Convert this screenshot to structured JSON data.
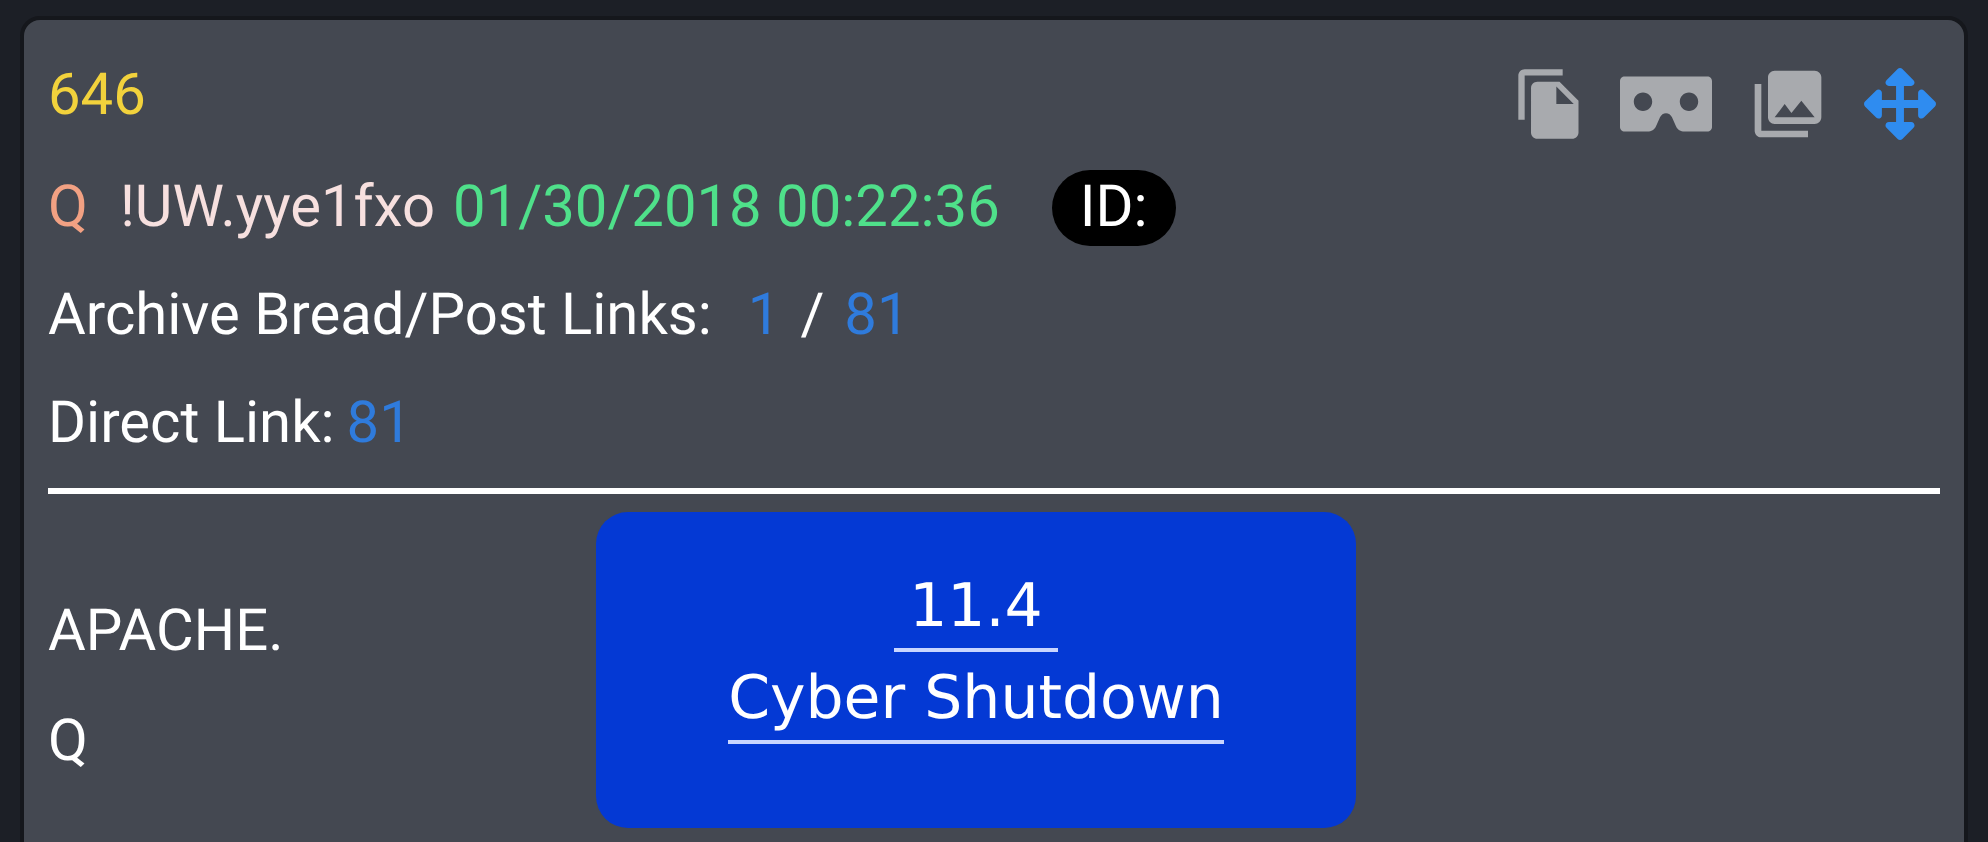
{
  "post": {
    "number": "646",
    "author": "Q",
    "tripcode": "!UW.yye1fxo",
    "timestamp": "01/30/2018 00:22:36",
    "id_badge": "ID:",
    "archive": {
      "label": "Archive Bread/Post Links:",
      "bread_link": "1",
      "separator": "/",
      "post_link": "81"
    },
    "direct": {
      "label": "Direct Link:",
      "link": "81"
    },
    "body": [
      "APACHE.",
      "Q"
    ],
    "image_text": [
      "11.4",
      "Cyber Shutdown"
    ]
  }
}
